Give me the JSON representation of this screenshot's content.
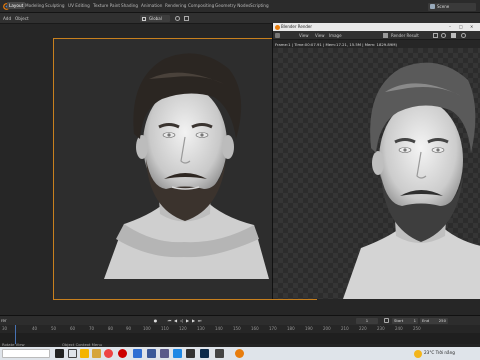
{
  "topbar": {
    "workspaces": [
      "Layout",
      "Modeling",
      "Sculpting",
      "UV Editing",
      "Texture Paint",
      "Shading",
      "Animation",
      "Rendering",
      "Compositing",
      "Geometry Nodes",
      "Scripting"
    ],
    "active_workspace": "Layout",
    "scene": "Scene"
  },
  "header2": {
    "add": "Add",
    "object": "Object",
    "orientation": "Global"
  },
  "render_window": {
    "title": "Blender Render",
    "menu": [
      "View",
      "View",
      "Image"
    ],
    "render_slot": "Render Result",
    "info": "Frame:1 | Time:00:07.91 | Mem:17.21, 15.5M | Mem: 1829.89M)"
  },
  "timeline": {
    "left_label": "rer",
    "ruler": [
      "30",
      "40",
      "50",
      "60",
      "70",
      "80",
      "90",
      "100",
      "110",
      "120",
      "130",
      "140",
      "150",
      "160",
      "170",
      "180",
      "190",
      "200",
      "210",
      "220",
      "230",
      "240",
      "250"
    ],
    "current_frame": "1",
    "start_label": "Start",
    "start_value": "1",
    "end_label": "End",
    "end_value": "250"
  },
  "status": {
    "left": "Rotate View",
    "middle": "Object Context Menu"
  },
  "taskbar": {
    "weather": "23°C  Trời nắng"
  },
  "colors": {
    "camera_frame": "#c8801e",
    "accent": "#4772b3"
  }
}
